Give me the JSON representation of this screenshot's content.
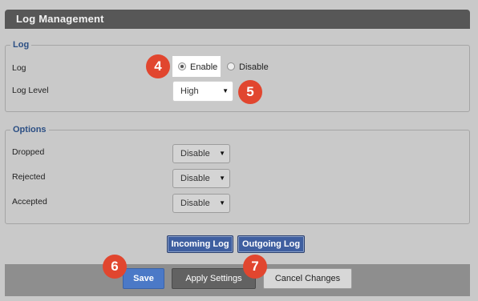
{
  "header": {
    "title": "Log Management"
  },
  "log_group": {
    "legend": "Log",
    "log_label": "Log",
    "enable_label": "Enable",
    "disable_label": "Disable",
    "log_selected": "Enable",
    "level_label": "Log Level",
    "level_value": "High"
  },
  "options_group": {
    "legend": "Options",
    "dropped_label": "Dropped",
    "dropped_value": "Disable",
    "rejected_label": "Rejected",
    "rejected_value": "Disable",
    "accepted_label": "Accepted",
    "accepted_value": "Disable"
  },
  "log_buttons": {
    "incoming": "Incoming Log",
    "outgoing": "Outgoing Log"
  },
  "footer": {
    "save": "Save",
    "apply": "Apply Settings",
    "cancel": "Cancel Changes"
  },
  "callouts": {
    "c4": "4",
    "c5": "5",
    "c6": "6",
    "c7": "7"
  },
  "icons": {
    "dropdown": "chevron-down-icon"
  },
  "colors": {
    "callout": "#e1462f",
    "primary_button": "#4b79c7",
    "legend_text": "#2c4f84",
    "header_bg": "#575757"
  }
}
